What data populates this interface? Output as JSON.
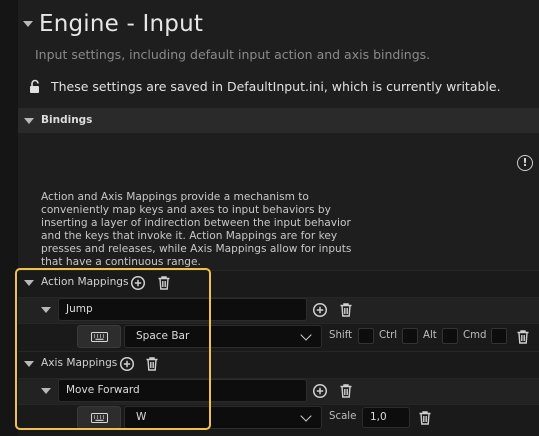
{
  "header": {
    "title": "Engine - Input",
    "subtitle": "Input settings, including default input action and axis bindings.",
    "saved_notice": "These settings are saved in DefaultInput.ini, which is currently writable."
  },
  "bindings": {
    "section_label": "Bindings",
    "description": "Action and Axis Mappings provide a mechanism to conveniently map keys and axes to input behaviors by inserting a layer of indirection between the input behavior and the keys that invoke it. Action Mappings are for key presses and releases, while Axis Mappings allow for inputs that have a continuous range.",
    "info_icon_glyph": "!"
  },
  "action_mappings": {
    "label": "Action Mappings",
    "entry_name": "Jump",
    "key": "Space Bar",
    "modifiers": [
      "Shift",
      "Ctrl",
      "Alt",
      "Cmd"
    ]
  },
  "axis_mappings": {
    "label": "Axis Mappings",
    "entry_name": "Move Forward",
    "key": "W",
    "scale_label": "Scale",
    "scale_value": "1,0"
  },
  "colors": {
    "highlight": "#f0c24a",
    "background": "#1e1e1e"
  }
}
